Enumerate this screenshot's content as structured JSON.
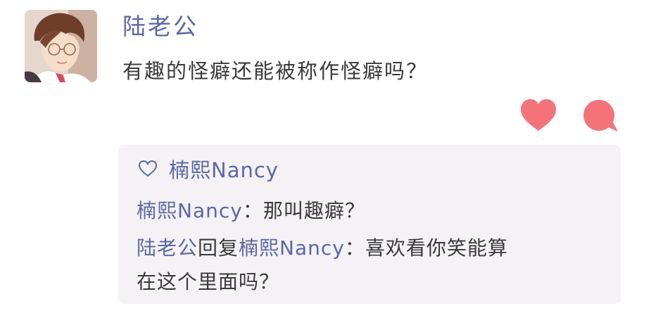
{
  "post": {
    "author_name": "陆老公",
    "text": "有趣的怪癖还能被称作怪癖吗？",
    "avatar_icon": "male-character-portrait"
  },
  "actions": {
    "like_icon": "heart-icon",
    "comment_icon": "comment-bubble-icon",
    "color": "#f4737a"
  },
  "likes": {
    "icon": "heart-outline-icon",
    "names": "楠熙Nancy"
  },
  "comments": [
    {
      "author": "楠熙Nancy",
      "separator": "：",
      "text": "那叫趣癖？"
    },
    {
      "author": "陆老公",
      "reply_word": "回复",
      "reply_to": "楠熙Nancy",
      "separator": "：",
      "text_line1": "喜欢看你笑能算",
      "text_line2": "在这个里面吗？"
    }
  ],
  "colors": {
    "name_link": "#5b67a6",
    "body_text": "#3a3a3a",
    "comment_bg": "#f4f2f5"
  }
}
